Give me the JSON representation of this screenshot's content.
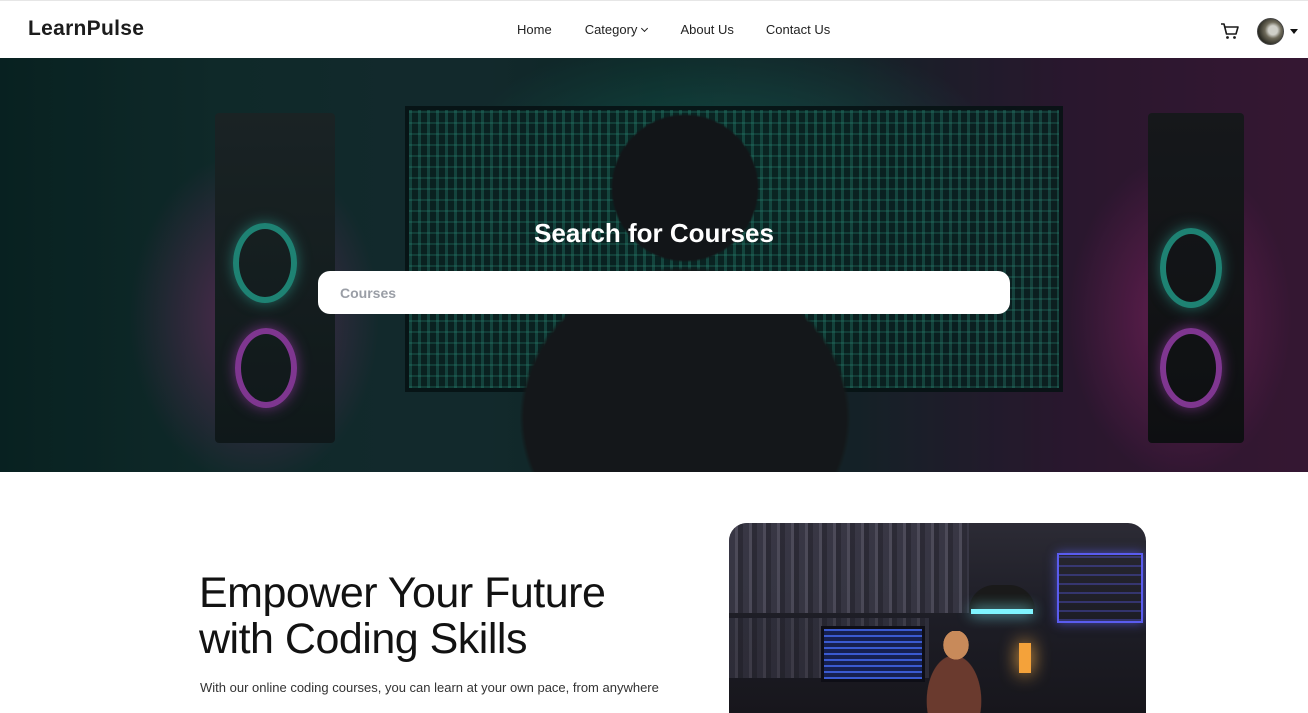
{
  "navbar": {
    "brand": "LearnPulse",
    "links": {
      "home": "Home",
      "category": "Category",
      "about": "About Us",
      "contact": "Contact Us"
    }
  },
  "hero": {
    "title": "Search for Courses",
    "search_placeholder": "Courses"
  },
  "intro": {
    "headline": "Empower Your Future with Coding Skills",
    "subtext": "With our online coding courses, you can learn at your own pace, from anywhere"
  },
  "icons": {
    "cart": "cart-icon",
    "avatar": "user-avatar",
    "dropdown": "chevron-down-icon"
  }
}
